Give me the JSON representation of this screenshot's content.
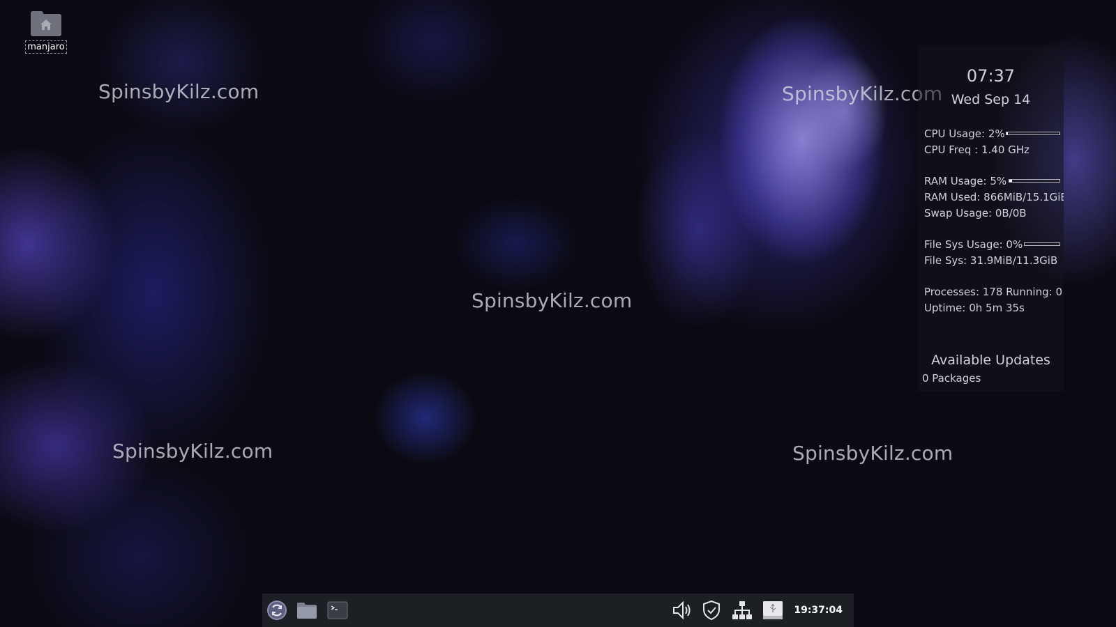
{
  "desktop": {
    "icons": [
      {
        "label": "manjaro",
        "icon": "home-folder-icon"
      }
    ],
    "watermark_text": "SpinsbyKilz.com",
    "colors": {
      "accent": "#6a5cf0",
      "background": "#0b0a12"
    }
  },
  "conky": {
    "clock": "07:37",
    "date": "Wed Sep 14",
    "cpu_usage": "CPU Usage: 2%",
    "cpu_usage_level": 0.02,
    "cpu_freq": "CPU Freq : 1.40 GHz",
    "ram_usage": "RAM Usage: 5%",
    "ram_usage_level": 0.05,
    "ram_used": "RAM Used: 866MiB/15.1GiB",
    "swap_usage": "Swap Usage: 0B/0B",
    "fs_usage": "File Sys Usage:  0%",
    "fs_usage_level": 0.0,
    "fs": "File Sys: 31.9MiB/11.3GiB",
    "processes": "Processes: 178   Running: 0",
    "uptime": "Uptime: 0h 5m 35s",
    "updates_title": "Available Updates",
    "updates_value": "0 Packages"
  },
  "taskbar": {
    "launchers": [
      "manjaro-menu-icon",
      "file-manager-icon",
      "terminal-icon"
    ],
    "tray": [
      "volume-icon",
      "shield-icon",
      "network-icon",
      "usb-drive-icon"
    ],
    "clock": "19:37:04",
    "background": "#1c1f24"
  }
}
